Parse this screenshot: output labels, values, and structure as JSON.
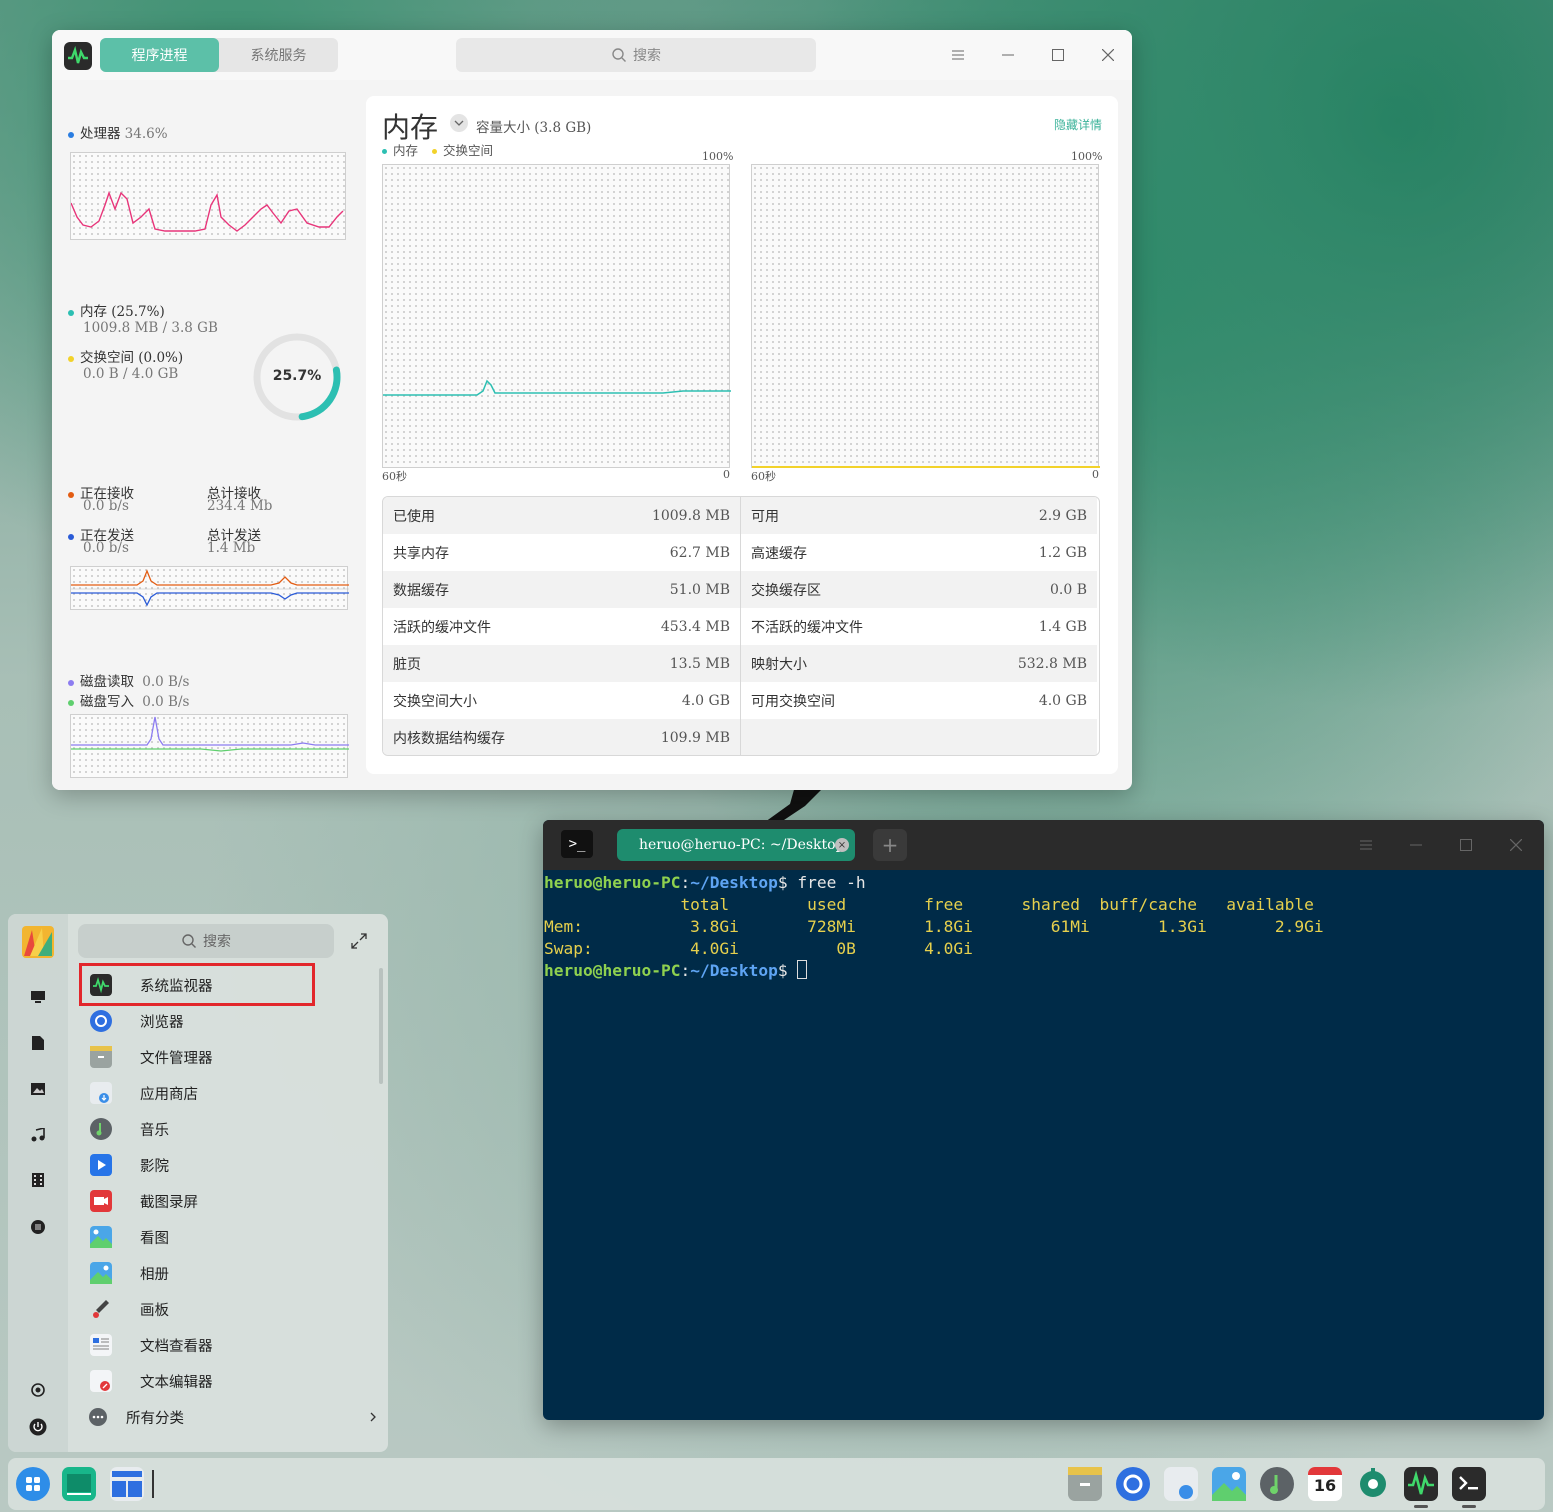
{
  "monitor": {
    "tabs": [
      "程序进程",
      "系统服务"
    ],
    "search_placeholder": "搜索",
    "cpu": {
      "label": "处理器",
      "value": "34.6%"
    },
    "memory": {
      "label": "内存 (25.7%)",
      "detail": "1009.8 MB / 3.8 GB"
    },
    "swap": {
      "label": "交换空间 (0.0%)",
      "detail": "0.0 B / 4.0 GB"
    },
    "ring_value": "25.7%",
    "ring_fraction": 0.257,
    "net": {
      "recv_label": "正在接收",
      "recv_value": "0.0 b/s",
      "total_recv_label": "总计接收",
      "total_recv_value": "234.4 Mb",
      "send_label": "正在发送",
      "send_value": "0.0 b/s",
      "total_send_label": "总计发送",
      "total_send_value": "1.4 Mb"
    },
    "disk": {
      "read_label": "磁盘读取",
      "read_value": "0.0 B/s",
      "write_label": "磁盘写入",
      "write_value": "0.0 B/s"
    },
    "detail": {
      "title": "内存",
      "capacity": "容量大小 (3.8 GB)",
      "hide_link": "隐藏详情",
      "legend_mem": "内存",
      "legend_swap": "交换空间",
      "pct_label": "100%",
      "time_start": "60秒",
      "time_end": "0",
      "left_rows": [
        {
          "k": "已使用",
          "v": "1009.8 MB"
        },
        {
          "k": "共享内存",
          "v": "62.7 MB"
        },
        {
          "k": "数据缓存",
          "v": "51.0 MB"
        },
        {
          "k": "活跃的缓冲文件",
          "v": "453.4 MB"
        },
        {
          "k": "脏页",
          "v": "13.5 MB"
        },
        {
          "k": "交换空间大小",
          "v": "4.0 GB"
        },
        {
          "k": "内核数据结构缓存",
          "v": "109.9 MB"
        }
      ],
      "right_rows": [
        {
          "k": "可用",
          "v": "2.9 GB"
        },
        {
          "k": "高速缓存",
          "v": "1.2 GB"
        },
        {
          "k": "交换缓存区",
          "v": "0.0 B"
        },
        {
          "k": "不活跃的缓冲文件",
          "v": "1.4 GB"
        },
        {
          "k": "映射大小",
          "v": "532.8 MB"
        },
        {
          "k": "可用交换空间",
          "v": "4.0 GB"
        }
      ]
    },
    "colors": {
      "accent": "#5cc0a8",
      "cpu": "#e8357a",
      "mem": "#2cbfb2",
      "swap": "#f2d22a",
      "recv": "#e35c12",
      "send": "#2a5bd7",
      "disk_read": "#8c7cf0",
      "disk_write": "#5fcf6e"
    }
  },
  "terminal": {
    "tab_title": "heruo@heruo-PC: ~/Desktop",
    "add_label": "+",
    "prompt_user": "heruo@heruo-PC",
    "prompt_path": "~/Desktop",
    "command": "free -h",
    "header": "              total        used        free      shared  buff/cache   available",
    "mem_line": "Mem:           3.8Gi       728Mi       1.8Gi        61Mi       1.3Gi       2.9Gi",
    "swap_line": "Swap:          4.0Gi          0B       4.0Gi"
  },
  "launcher": {
    "search_placeholder": "搜索",
    "apps": [
      "系统监视器",
      "浏览器",
      "文件管理器",
      "应用商店",
      "音乐",
      "影院",
      "截图录屏",
      "看图",
      "相册",
      "画板",
      "文档查看器",
      "文本编辑器"
    ],
    "all_categories": "所有分类"
  },
  "dock": {
    "calendar_day": "16"
  }
}
